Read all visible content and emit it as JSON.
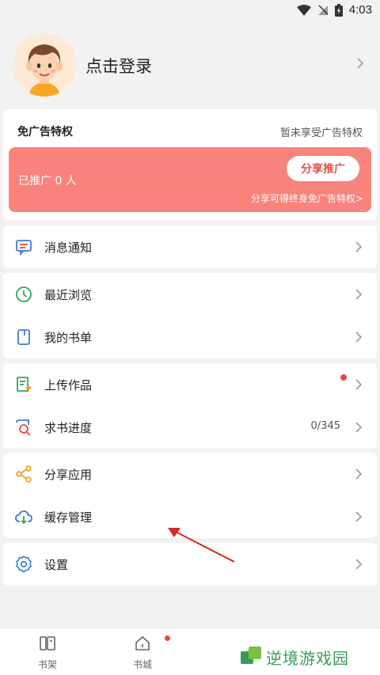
{
  "status_bar": {
    "time": "4:03",
    "icons": [
      "wifi-icon",
      "no-signal-icon",
      "battery-charging-icon"
    ]
  },
  "profile": {
    "login_label": "点击登录"
  },
  "ad_free": {
    "title": "免广告特权",
    "status": "暂未享受广告特权",
    "promoted": "已推广 0 人",
    "share_button": "分享推广",
    "share_hint": "分享可得终身免广告特权>"
  },
  "menu": {
    "messages": "消息通知",
    "recent": "最近浏览",
    "booklist": "我的书单",
    "upload": "上传作品",
    "request": "求书进度",
    "request_progress": "0/345",
    "share_app": "分享应用",
    "cache": "缓存管理",
    "settings": "设置"
  },
  "nav": {
    "bookshelf": "书架",
    "bookstore": "书城"
  },
  "watermark": {
    "text": "逆境游戏园"
  },
  "colors": {
    "banner": "#f8837d",
    "accent_red": "#e04a44",
    "watermark_green": "#3a9a57"
  }
}
